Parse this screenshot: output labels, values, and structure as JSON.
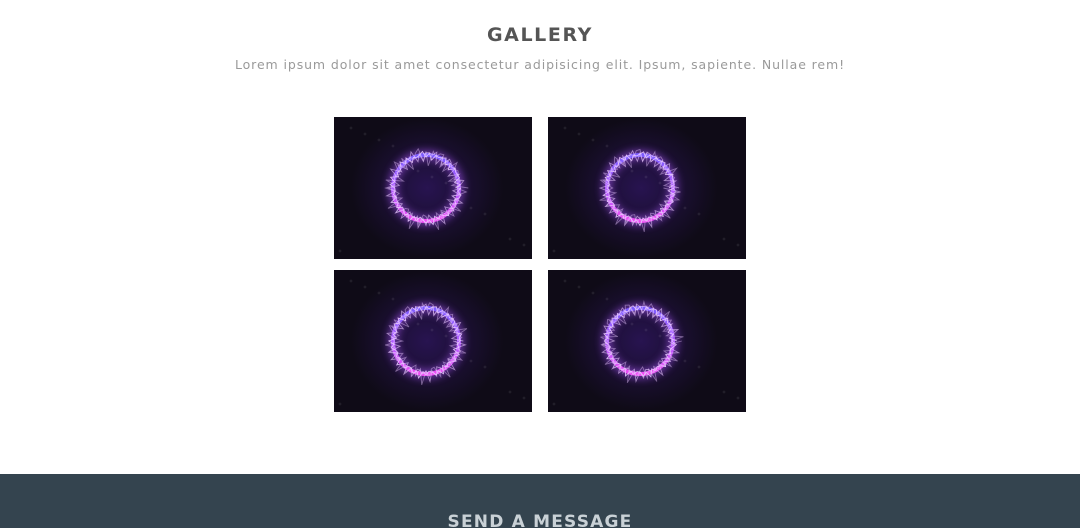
{
  "gallery": {
    "title": "GALLERY",
    "subtitle": "Lorem ipsum dolor sit amet consectetur adipisicing elit. Ipsum, sapiente. Nullae rem!",
    "images": [
      {
        "alt": "glowing purple electric ring"
      },
      {
        "alt": "glowing purple electric ring"
      },
      {
        "alt": "glowing purple electric ring"
      },
      {
        "alt": "glowing purple electric ring"
      }
    ]
  },
  "contact": {
    "title": "SEND A MESSAGE"
  },
  "colors": {
    "heading": "#555555",
    "subtitle": "#9a9a9a",
    "tile_background": "#0f0b17",
    "ring_glow": "#a855f7",
    "footer_background": "#34444f",
    "footer_text": "#c9d1d6"
  }
}
